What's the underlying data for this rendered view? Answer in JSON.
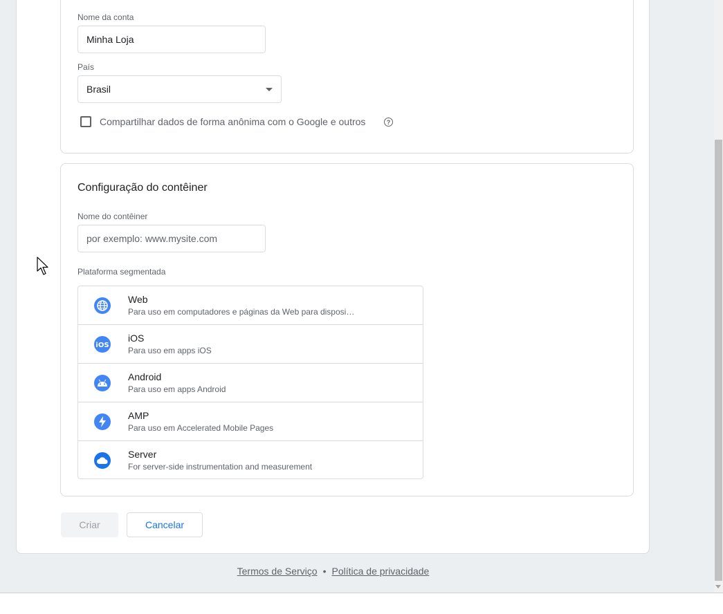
{
  "account": {
    "name_label": "Nome da conta",
    "name_value": "Minha Loja",
    "country_label": "País",
    "country_value": "Brasil",
    "share_label": "Compartilhar dados de forma anônima com o Google e outros",
    "help_glyph": "?"
  },
  "container": {
    "title": "Configuração do contêiner",
    "name_label": "Nome do contêiner",
    "name_placeholder": "por exemplo: www.mysite.com",
    "platform_label": "Plataforma segmentada",
    "platforms": [
      {
        "name": "Web",
        "desc": "Para uso em computadores e páginas da Web para dispositivos móveis",
        "icon": "globe-icon"
      },
      {
        "name": "iOS",
        "desc": "Para uso em apps iOS",
        "icon": "ios-icon"
      },
      {
        "name": "Android",
        "desc": "Para uso em apps Android",
        "icon": "android-icon"
      },
      {
        "name": "AMP",
        "desc": "Para uso em Accelerated Mobile Pages",
        "icon": "bolt-icon"
      },
      {
        "name": "Server",
        "desc": "For server-side instrumentation and measurement",
        "icon": "cloud-icon"
      }
    ]
  },
  "actions": {
    "create_label": "Criar",
    "cancel_label": "Cancelar"
  },
  "footer": {
    "terms": "Termos de Serviço",
    "separator": "•",
    "privacy": "Política de privacidade"
  },
  "colors": {
    "accent": "#1a73e8",
    "icon_blue": "#4285f4"
  }
}
